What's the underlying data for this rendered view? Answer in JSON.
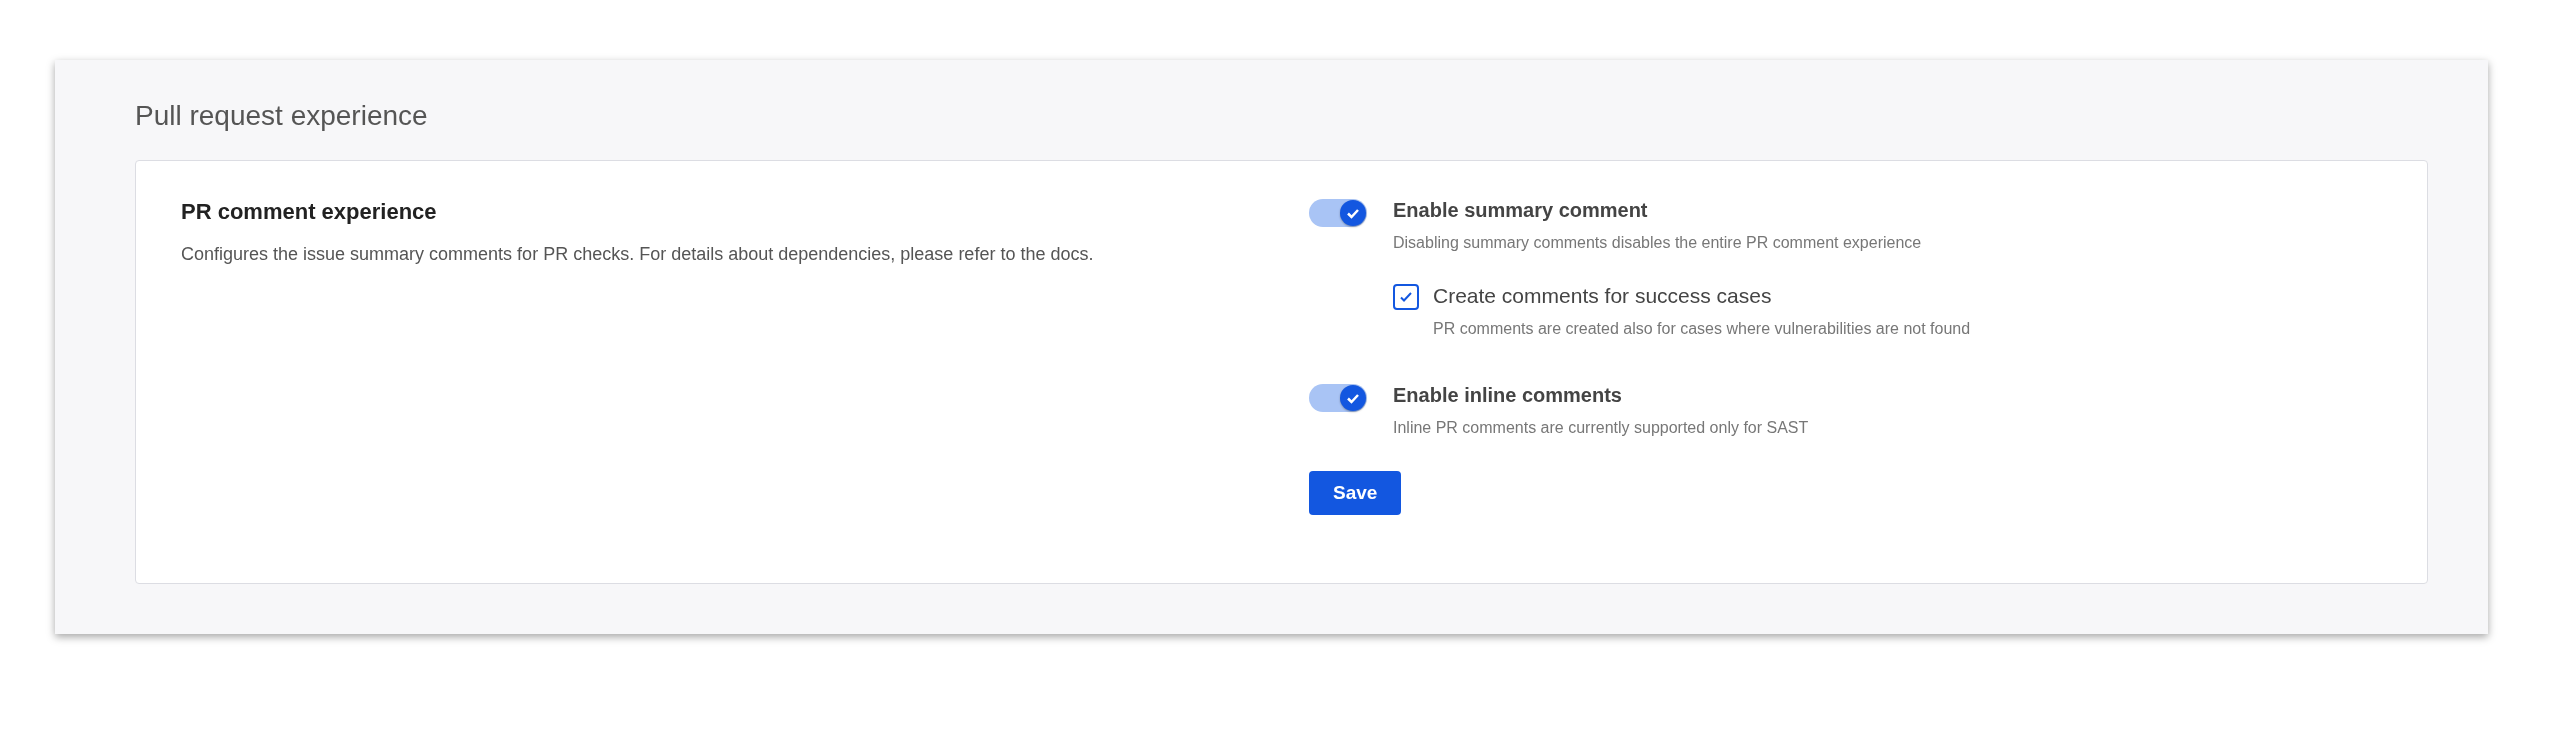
{
  "panel": {
    "title": "Pull request experience"
  },
  "section": {
    "heading": "PR comment experience",
    "description": "Configures the issue summary comments for PR checks. For details about dependencies, please refer to the docs."
  },
  "options": [
    {
      "kind": "toggle",
      "label": "Enable summary comment",
      "hint": "Disabling summary comments disables the entire PR comment experience",
      "on": true,
      "children": [
        {
          "kind": "checkbox",
          "label": "Create comments for success cases",
          "hint": "PR comments are created also for cases where vulnerabilities are not found",
          "checked": true
        }
      ]
    },
    {
      "kind": "toggle",
      "label": "Enable inline comments",
      "hint": "Inline PR comments are currently supported only for SAST",
      "on": true
    }
  ],
  "save_button": "Save"
}
